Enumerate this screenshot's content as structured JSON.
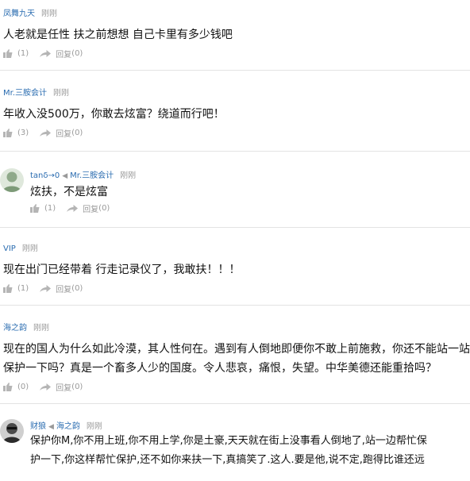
{
  "comments": [
    {
      "author": "凤舞九天",
      "time": "刚刚",
      "text": [
        "人老就是任性 扶之前想想 自己卡里有多少钱吧"
      ],
      "likes": "(1)",
      "reply_label": "回复",
      "replies": "(0)"
    },
    {
      "author": "Mr.三胺会计",
      "time": "刚刚",
      "text": [
        "年收入没500万，你敢去炫富？绕道而行吧！"
      ],
      "likes": "(3)",
      "reply_label": "回复",
      "replies": "(0)"
    },
    {
      "author": "tanδ→0",
      "reply_to": "Mr.三胺会计",
      "time": "刚刚",
      "text": [
        "炫扶，不是炫富"
      ],
      "likes": "(1)",
      "reply_label": "回复",
      "replies": "(0)"
    },
    {
      "author": "VIP",
      "time": "刚刚",
      "text": [
        "现在出门已经带着 行走记录仪了，我敢扶！！！"
      ],
      "likes": "(1)",
      "reply_label": "回复",
      "replies": "(0)"
    },
    {
      "author": "海之韵",
      "time": "刚刚",
      "text": [
        "现在的国人为什么如此冷漠，其人性何在。遇到有人倒地即便你不敢上前施救，你还不能站一站",
        "保护一下吗？真是一个畜多人少的国度。令人悲哀，痛恨，失望。中华美德还能重拾吗？"
      ],
      "likes": "(0)",
      "reply_label": "回复",
      "replies": "(0)"
    },
    {
      "author": "财狼",
      "reply_to": "海之韵",
      "time": "刚刚",
      "text": [
        "保护你M,你不用上班,你不用上学,你是土豪,天天就在街上没事看人倒地了,站一边帮忙保",
        "护一下,你这样帮忙保护,还不如你来扶一下,真搞笑了.这人.要是他,说不定,跑得比谁还远"
      ]
    }
  ]
}
